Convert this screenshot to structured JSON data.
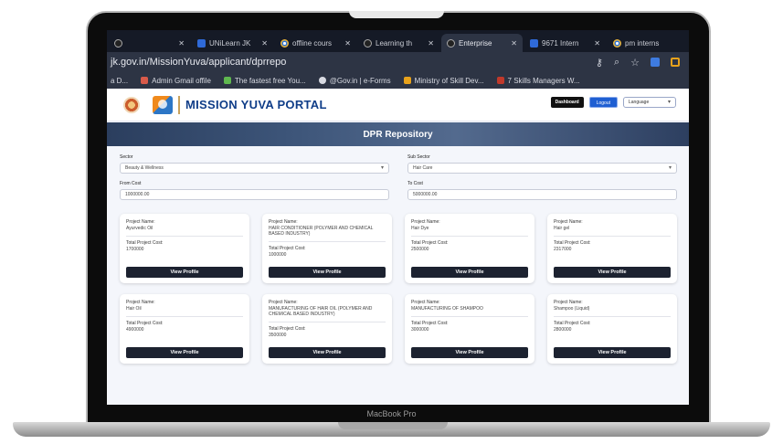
{
  "laptop": {
    "model_label": "MacBook Pro"
  },
  "browser": {
    "tabs": [
      {
        "title": "",
        "icon": "tab-icon"
      },
      {
        "title": "UNiLearn JK",
        "icon": "unilearn-icon"
      },
      {
        "title": "offline cours",
        "icon": "chrome-icon"
      },
      {
        "title": "Learning th",
        "icon": "learning-icon"
      },
      {
        "title": "Enterprise",
        "icon": "enterprise-icon",
        "active": true
      },
      {
        "title": "9671 Intern",
        "icon": "intern-icon"
      },
      {
        "title": "pm interns",
        "icon": "chrome-icon"
      }
    ],
    "url": "jk.gov.in/MissionYuva/applicant/dprrepo",
    "bookmarks": [
      {
        "label": "a D...",
        "color": "#5b8fd8"
      },
      {
        "label": "Admin Gmail offile",
        "color": "#d85a4a"
      },
      {
        "label": "The fastest free You...",
        "color": "#5fb84f"
      },
      {
        "label": "@Gov.in | e-Forms",
        "color": "#d8dae2"
      },
      {
        "label": "Ministry of Skill Dev...",
        "color": "#e8a21b"
      },
      {
        "label": "7 Skills Managers W...",
        "color": "#c0392b"
      }
    ]
  },
  "portal": {
    "title": "MISSION YUVA PORTAL",
    "dashboard_label": "Dashboard",
    "logout_label": "Logout",
    "language_label": "Language",
    "page_title": "DPR Repository",
    "filters": {
      "sector_label": "Sector",
      "sector_value": "Beauty & Wellness",
      "subsector_label": "Sub Sector",
      "subsector_value": "Hair Care",
      "from_cost_label": "From Cost",
      "from_cost_value": "1000000.00",
      "to_cost_label": "To Cost",
      "to_cost_value": "5000000.00"
    },
    "card_labels": {
      "project_name": "Project Name:",
      "total_cost": "Total Project Cost:",
      "view_button": "View Profile"
    },
    "cards": [
      {
        "name": "Ayurvedic Oil",
        "cost": "1700000"
      },
      {
        "name": "HAIR CONDITIONER (POLYMER AND CHEMICAL BASED INDUSTRY)",
        "cost": "1000000"
      },
      {
        "name": "Hair Dye",
        "cost": "2500000"
      },
      {
        "name": "Hair gel",
        "cost": "2317000"
      },
      {
        "name": "Hair Oil",
        "cost": "4900000"
      },
      {
        "name": "MANUFACTURING OF HAIR OIL (POLYMER AND CHEMICAL BASED INDUSTRY)",
        "cost": "3500000"
      },
      {
        "name": "MANUFACTURING OF SHAMPOO",
        "cost": "3000000"
      },
      {
        "name": "Shampoo (Liquid)",
        "cost": "2800000"
      }
    ]
  }
}
